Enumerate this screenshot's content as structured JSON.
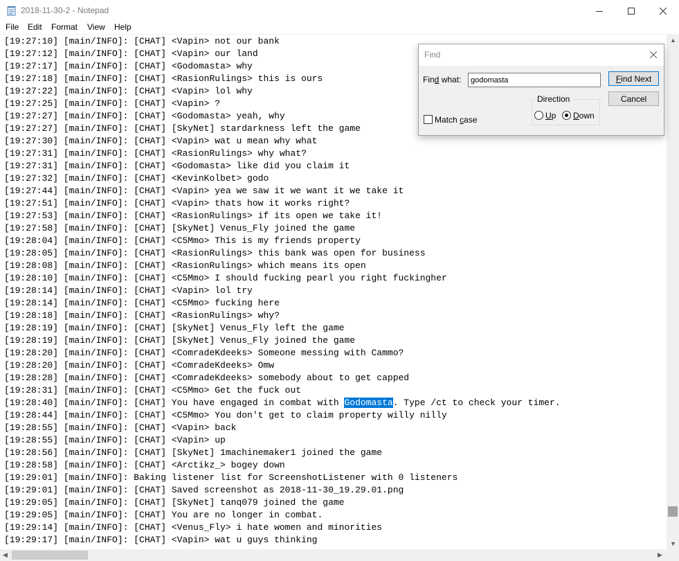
{
  "window": {
    "title": "2018-11-30-2 - Notepad"
  },
  "menu": [
    "File",
    "Edit",
    "Format",
    "View",
    "Help"
  ],
  "editor": {
    "lines": [
      "[19:27:10] [main/INFO]: [CHAT] <Vapin> not our bank",
      "[19:27:12] [main/INFO]: [CHAT] <Vapin> our land",
      "[19:27:17] [main/INFO]: [CHAT] <Godomasta> why",
      "[19:27:18] [main/INFO]: [CHAT] <RasionRulings> this is ours",
      "[19:27:22] [main/INFO]: [CHAT] <Vapin> lol why",
      "[19:27:25] [main/INFO]: [CHAT] <Vapin> ?",
      "[19:27:27] [main/INFO]: [CHAT] <Godomasta> yeah, why",
      "[19:27:27] [main/INFO]: [CHAT] [SkyNet] stardarkness left the game",
      "[19:27:30] [main/INFO]: [CHAT] <Vapin> wat u mean why what",
      "[19:27:31] [main/INFO]: [CHAT] <RasionRulings> why what?",
      "[19:27:31] [main/INFO]: [CHAT] <Godomasta> like did you claim it",
      "[19:27:32] [main/INFO]: [CHAT] <KevinKolbet> godo",
      "[19:27:44] [main/INFO]: [CHAT] <Vapin> yea we saw it we want it we take it",
      "[19:27:51] [main/INFO]: [CHAT] <Vapin> thats how it works right?",
      "[19:27:53] [main/INFO]: [CHAT] <RasionRulings> if its open we take it!",
      "[19:27:58] [main/INFO]: [CHAT] [SkyNet] Venus_Fly joined the game",
      "[19:28:04] [main/INFO]: [CHAT] <C5Mmo> This is my friends property",
      "[19:28:05] [main/INFO]: [CHAT] <RasionRulings> this bank was open for business",
      "[19:28:08] [main/INFO]: [CHAT] <RasionRulings> which means its open",
      "[19:28:10] [main/INFO]: [CHAT] <C5Mmo> I should fucking pearl you right fuckingher",
      "[19:28:14] [main/INFO]: [CHAT] <Vapin> lol try",
      "[19:28:14] [main/INFO]: [CHAT] <C5Mmo> fucking here",
      "[19:28:18] [main/INFO]: [CHAT] <RasionRulings> why?",
      "[19:28:19] [main/INFO]: [CHAT] [SkyNet] Venus_Fly left the game",
      "[19:28:19] [main/INFO]: [CHAT] [SkyNet] Venus_Fly joined the game",
      "[19:28:20] [main/INFO]: [CHAT] <ComradeKdeeks> Someone messing with Cammo?",
      "[19:28:20] [main/INFO]: [CHAT] <ComradeKdeeks> Omw",
      "[19:28:28] [main/INFO]: [CHAT] <ComradeKdeeks> somebody about to get capped",
      "[19:28:31] [main/INFO]: [CHAT] <C5Mmo> Get the fuck out",
      "[19:28:40] [main/INFO]: [CHAT] You have engaged in combat with ",
      "[19:28:44] [main/INFO]: [CHAT] <C5Mmo> You don't get to claim property willy nilly",
      "[19:28:55] [main/INFO]: [CHAT] <Vapin> back",
      "[19:28:55] [main/INFO]: [CHAT] <Vapin> up",
      "[19:28:56] [main/INFO]: [CHAT] [SkyNet] 1machinemaker1 joined the game",
      "[19:28:58] [main/INFO]: [CHAT] <Arctikz_> bogey down",
      "[19:29:01] [main/INFO]: Baking listener list for ScreenshotListener with 0 listeners",
      "[19:29:01] [main/INFO]: [CHAT] Saved screenshot as 2018-11-30_19.29.01.png",
      "[19:29:05] [main/INFO]: [CHAT] [SkyNet] tanq079 joined the game",
      "[19:29:05] [main/INFO]: [CHAT] You are no longer in combat.",
      "[19:29:14] [main/INFO]: [CHAT] <Venus_Fly> i hate women and minorities",
      "[19:29:17] [main/INFO]: [CHAT] <Vapin> wat u guys thinking"
    ],
    "highlight_line": 29,
    "highlight_text": "Godomasta",
    "highlight_suffix": ". Type /ct to check your timer.",
    "selection_color": "#0078d7"
  },
  "find_dialog": {
    "title": "Find",
    "find_what_label": "Find what:",
    "find_what_value": "godomasta",
    "find_next_label": "Find Next",
    "cancel_label": "Cancel",
    "direction_label": "Direction",
    "up_label": "Up",
    "down_label": "Down",
    "direction_selected": "Down",
    "match_case_label": "Match case",
    "match_case_checked": false
  }
}
